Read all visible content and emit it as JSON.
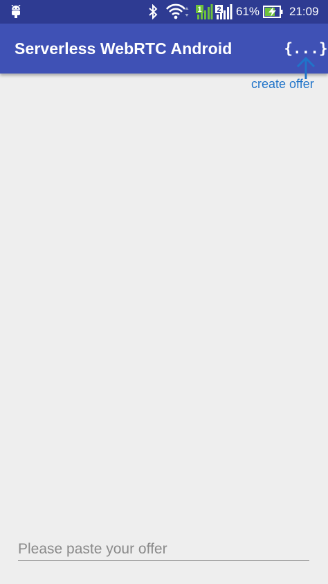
{
  "status_bar": {
    "battery_percent": "61%",
    "time": "21:09",
    "sim1_label": "1",
    "sim2_label": "2",
    "icons": [
      "android-debug-icon",
      "bluetooth-icon",
      "wifi-icon",
      "signal-sim1-icon",
      "signal-sim2-icon",
      "battery-charging-icon"
    ]
  },
  "toolbar": {
    "title": "Serverless WebRTC Android",
    "action_label": "{...}"
  },
  "annotation": {
    "label": "create offer"
  },
  "offer_input": {
    "placeholder": "Please paste your offer",
    "value": ""
  },
  "colors": {
    "status_bar": "#2e3b92",
    "toolbar": "#3f51b5",
    "background": "#eeeeee",
    "annotation": "#2074c9",
    "signal_green": "#6ec13c"
  }
}
